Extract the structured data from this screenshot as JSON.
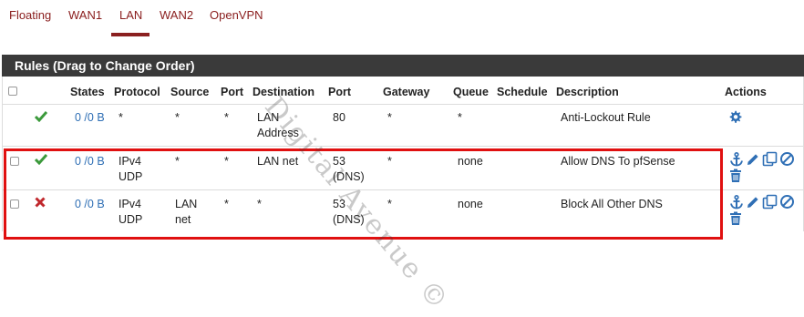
{
  "tabs": [
    "Floating",
    "WAN1",
    "LAN",
    "WAN2",
    "OpenVPN"
  ],
  "active_tab": "LAN",
  "panel_title": "Rules (Drag to Change Order)",
  "columns": {
    "states": "States",
    "protocol": "Protocol",
    "source": "Source",
    "port": "Port",
    "destination": "Destination",
    "dport": "Port",
    "gateway": "Gateway",
    "queue": "Queue",
    "schedule": "Schedule",
    "description": "Description",
    "actions": "Actions"
  },
  "rows": [
    {
      "status": "pass",
      "states": "0 /0 B",
      "protocol": "*",
      "protocol2": "",
      "source": "*",
      "source2": "",
      "port": "*",
      "destination": "LAN",
      "destination2": "Address",
      "dport": "80",
      "dport2": "",
      "gateway": "*",
      "queue": "*",
      "description": "Anti-Lockout Rule"
    },
    {
      "status": "pass",
      "states": "0 /0 B",
      "protocol": "IPv4",
      "protocol2": "UDP",
      "source": "*",
      "source2": "",
      "port": "*",
      "destination": "LAN net",
      "destination2": "",
      "dport": "53",
      "dport2": "(DNS)",
      "gateway": "*",
      "queue": "none",
      "description": "Allow DNS To pfSense"
    },
    {
      "status": "block",
      "states": "0 /0 B",
      "protocol": "IPv4",
      "protocol2": "UDP",
      "source": "LAN",
      "source2": "net",
      "port": "*",
      "destination": "*",
      "destination2": "",
      "dport": "53",
      "dport2": "(DNS)",
      "gateway": "*",
      "queue": "none",
      "description": "Block All Other DNS"
    }
  ],
  "watermark": "Digital Avenue ©",
  "colors": {
    "accent": "#8b2020",
    "header_bg": "#3a3a3a",
    "link": "#2f6fb5",
    "pass": "#3c9a3c",
    "block": "#c0282d",
    "highlight": "#e01010"
  }
}
